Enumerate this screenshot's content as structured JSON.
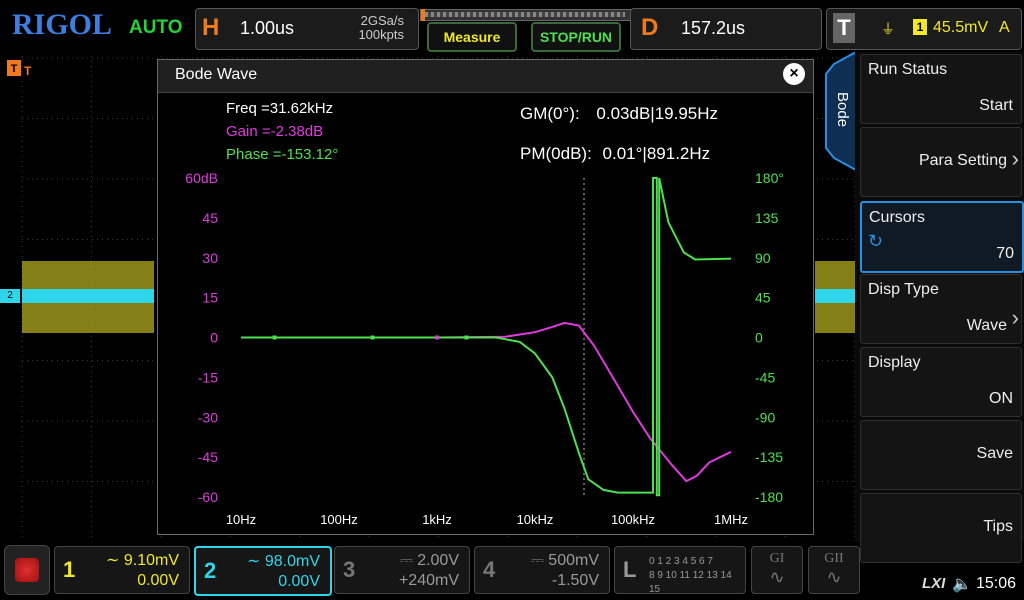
{
  "top": {
    "logo": "RIGOL",
    "trigger_mode": "AUTO",
    "h_letter": "H",
    "timebase": "1.00us",
    "sample_rate": "2GSa/s",
    "memory_depth": "100kpts",
    "measure_label": "Measure",
    "stoprun_label": "STOP/RUN",
    "d_letter": "D",
    "delay": "157.2us",
    "t_letter": "T",
    "trigger_source": "1",
    "trigger_level": "45.5mV",
    "trigger_coupling": "A"
  },
  "bode": {
    "title": "Bode Wave",
    "close": "×",
    "freq": "Freq =31.62kHz",
    "gain": "Gain =-2.38dB",
    "phase": "Phase =-153.12°",
    "gm_label": "GM(0°):",
    "gm_value": "0.03dB|19.95Hz",
    "pm_label": "PM(0dB):",
    "pm_value": "0.01°|891.2Hz",
    "gain_color": "#e03adf",
    "phase_color": "#4ee04e",
    "freq_color": "#ffffff"
  },
  "chart_data": {
    "type": "line",
    "x_scale": "log",
    "x_ticks": [
      "10Hz",
      "100Hz",
      "1kHz",
      "10kHz",
      "100kHz",
      "1MHz"
    ],
    "y_left_ticks": [
      "60dB",
      "45",
      "30",
      "15",
      "0",
      "-15",
      "-30",
      "-45",
      "-60"
    ],
    "y_right_ticks": [
      "180°",
      "135",
      "90",
      "45",
      "0",
      "-45",
      "-90",
      "-135",
      "-180"
    ],
    "ylim_left": [
      -60,
      60
    ],
    "ylim_right": [
      -180,
      180
    ],
    "cursor_freq": 31620,
    "series": [
      {
        "axis": "left",
        "color": "#e03adf",
        "points": [
          [
            10,
            0
          ],
          [
            100,
            0
          ],
          [
            1000,
            0
          ],
          [
            5000,
            0.3
          ],
          [
            10000,
            2
          ],
          [
            15000,
            4
          ],
          [
            20000,
            5.5
          ],
          [
            28000,
            4.5
          ],
          [
            40000,
            -3
          ],
          [
            60000,
            -14
          ],
          [
            100000,
            -28
          ],
          [
            150000,
            -38
          ],
          [
            250000,
            -48
          ],
          [
            350000,
            -54
          ],
          [
            450000,
            -52
          ],
          [
            600000,
            -47
          ],
          [
            1000000,
            -43
          ]
        ]
      },
      {
        "axis": "right",
        "color": "#4ee04e",
        "points": [
          [
            10,
            0
          ],
          [
            100,
            0
          ],
          [
            1000,
            0
          ],
          [
            4000,
            0
          ],
          [
            7000,
            -5
          ],
          [
            10000,
            -18
          ],
          [
            15000,
            -45
          ],
          [
            20000,
            -80
          ],
          [
            28000,
            -130
          ],
          [
            35000,
            -160
          ],
          [
            50000,
            -172
          ],
          [
            70000,
            -175
          ],
          [
            120000,
            -175
          ],
          [
            160000,
            -175
          ],
          [
            160000,
            180
          ],
          [
            175000,
            180
          ],
          [
            175000,
            -178
          ],
          [
            185000,
            -178
          ],
          [
            185000,
            180
          ],
          [
            230000,
            130
          ],
          [
            330000,
            96
          ],
          [
            430000,
            88
          ],
          [
            1000000,
            89
          ]
        ]
      }
    ]
  },
  "right_panel": {
    "tab_label": "Bode",
    "items": [
      {
        "title": "Run Status",
        "value": "Start",
        "arrow": ""
      },
      {
        "title": "",
        "value": "Para Setting",
        "arrow": "›"
      },
      {
        "title": "Cursors",
        "value": "70",
        "arrow": ""
      },
      {
        "title": "Disp Type",
        "value": "Wave",
        "arrow": "›"
      },
      {
        "title": "Display",
        "value": "ON",
        "arrow": ""
      },
      {
        "title": "",
        "value": "Save",
        "arrow": ""
      },
      {
        "title": "",
        "value": "Tips",
        "arrow": ""
      }
    ]
  },
  "channels": {
    "ch1": {
      "num": "1",
      "scale": "9.10mV",
      "offset": "0.00V",
      "color": "#f1e82a"
    },
    "ch2": {
      "num": "2",
      "scale": "98.0mV",
      "offset": "0.00V",
      "color": "#2fd6ea"
    },
    "ch3": {
      "num": "3",
      "scale": "2.00V",
      "offset": "+240mV",
      "color": "#777777"
    },
    "ch4": {
      "num": "4",
      "scale": "500mV",
      "offset": "-1.50V",
      "color": "#777777"
    },
    "la": {
      "letter": "L",
      "row1": "0 1 2 3  4 5 6 7",
      "row2": "8 9 10 11 12 13 14 15"
    },
    "g1": "GI",
    "g2": "GII"
  },
  "status": {
    "lxi": "LXI",
    "time": "15:06"
  },
  "markers": {
    "ch2_marker": "2"
  }
}
